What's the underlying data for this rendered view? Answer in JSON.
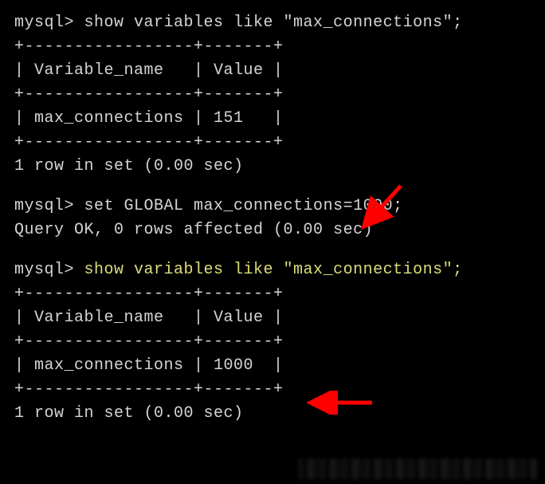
{
  "block1": {
    "prompt": "mysql> ",
    "command": "show variables like \"max_connections\";",
    "border_top": "+-----------------+-------+",
    "header": "| Variable_name   | Value |",
    "border_mid": "+-----------------+-------+",
    "row": "| max_connections | 151   |",
    "border_bot": "+-----------------+-------+",
    "footer": "1 row in set (0.00 sec)"
  },
  "block2": {
    "prompt": "mysql> ",
    "command": "set GLOBAL max_connections=1000;",
    "result": "Query OK, 0 rows affected (0.00 sec)"
  },
  "block3": {
    "prompt": "mysql> ",
    "command": "show variables like \"max_connections\";",
    "border_top": "+-----------------+-------+",
    "header": "| Variable_name   | Value |",
    "border_mid": "+-----------------+-------+",
    "row": "| max_connections | 1000  |",
    "border_bot": "+-----------------+-------+",
    "footer": "1 row in set (0.00 sec)"
  }
}
